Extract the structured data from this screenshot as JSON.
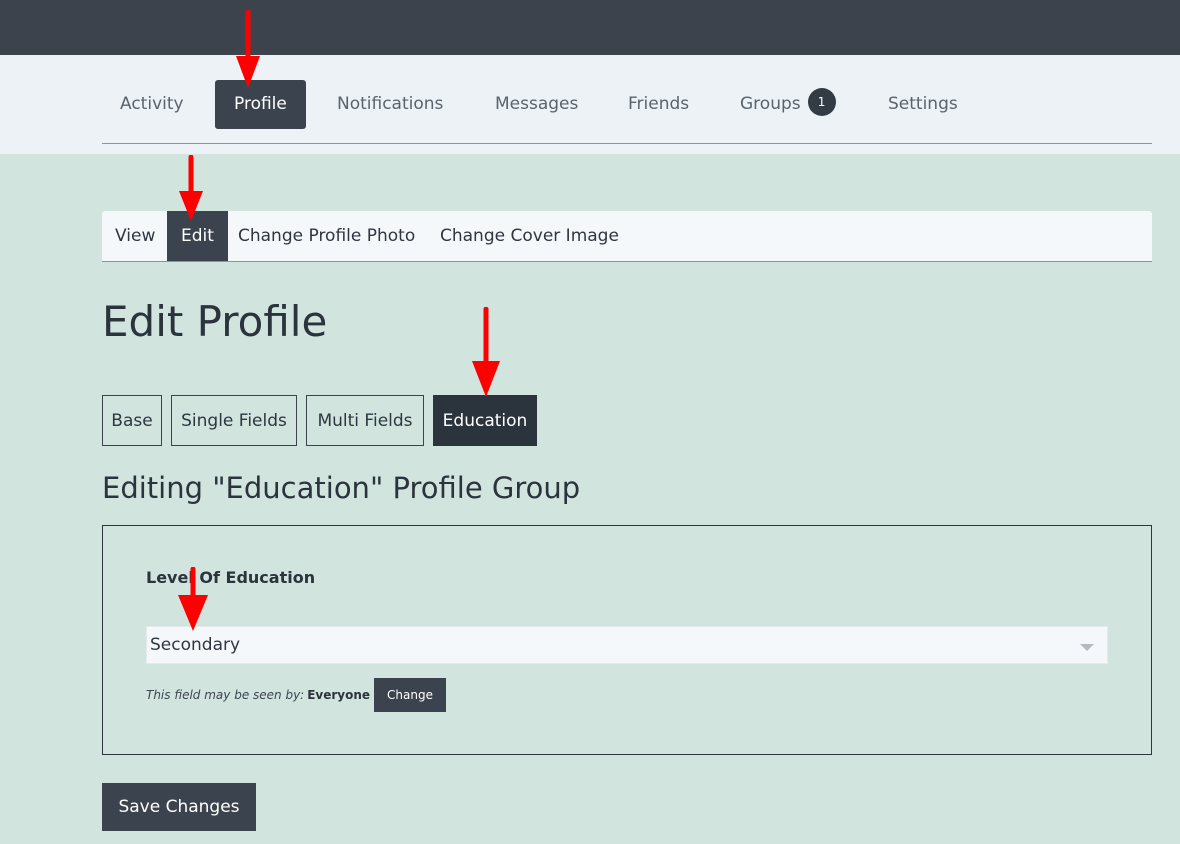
{
  "main_nav": {
    "items": [
      {
        "label": "Activity"
      },
      {
        "label": "Profile",
        "active": true
      },
      {
        "label": "Notifications"
      },
      {
        "label": "Messages"
      },
      {
        "label": "Friends"
      },
      {
        "label": "Groups",
        "badge": "1"
      },
      {
        "label": "Settings"
      }
    ]
  },
  "sub_nav": {
    "items": [
      {
        "label": "View"
      },
      {
        "label": "Edit",
        "active": true
      },
      {
        "label": "Change Profile Photo"
      },
      {
        "label": "Change Cover Image"
      }
    ]
  },
  "page": {
    "title": "Edit Profile"
  },
  "field_groups": {
    "tabs": [
      {
        "label": "Base"
      },
      {
        "label": "Single Fields"
      },
      {
        "label": "Multi Fields"
      },
      {
        "label": "Education",
        "active": true
      }
    ],
    "heading": "Editing \"Education\" Profile Group"
  },
  "field": {
    "label": "Level Of Education",
    "selected_value": "Secondary",
    "visibility_text": "This field may be seen by:",
    "visibility_level": "Everyone",
    "change_label": "Change"
  },
  "actions": {
    "save_label": "Save Changes"
  },
  "colors": {
    "top_bar": "#3d434d",
    "nav_background": "#ecf2f6",
    "page_background": "#d1e4de",
    "active_tab": "#3b444e",
    "annotation_arrow": "#ff0000"
  }
}
